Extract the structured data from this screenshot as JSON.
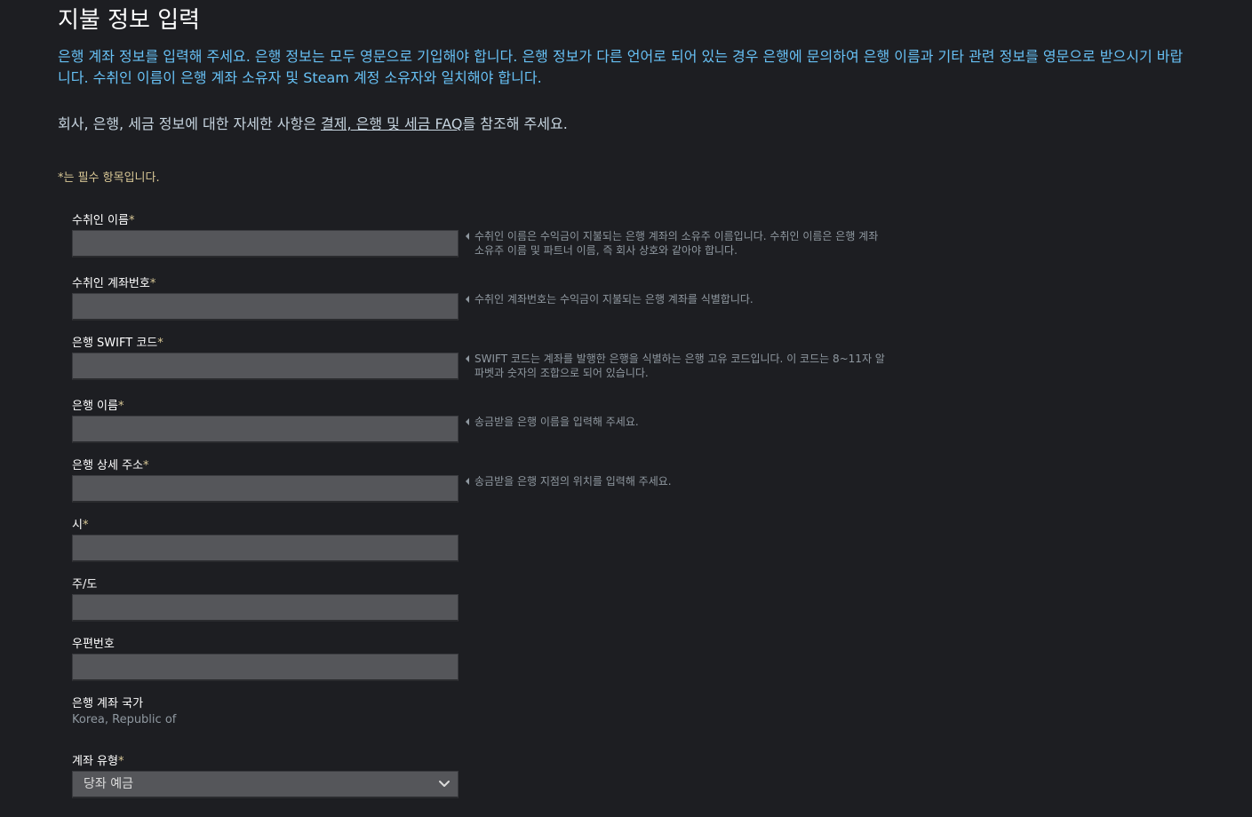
{
  "title": "지불 정보 입력",
  "intro": "은행 계좌 정보를 입력해 주세요. 은행 정보는 모두 영문으로 기입해야 합니다. 은행 정보가 다른 언어로 되어 있는 경우 은행에 문의하여 은행 이름과 기타 관련 정보를 영문으로 받으시기 바랍니다. 수취인 이름이 은행 계좌 소유자 및 Steam 계정 소유자와 일치해야 합니다.",
  "faq": {
    "prefix": "회사, 은행, 세금 정보에 대한 자세한 사항은 ",
    "link": "결제, 은행 및 세금 FAQ",
    "suffix": "를 참조해 주세요."
  },
  "required_note": "*는 필수 항목입니다.",
  "required_mark": "*",
  "fields": {
    "payee_name": {
      "label": "수취인 이름",
      "value": "",
      "hint": "수취인 이름은 수익금이 지불되는 은행 계좌의 소유주 이름입니다. 수취인 이름은 은행 계좌 소유주 이름 및 파트너 이름, 즉 회사 상호와 같아야 합니다."
    },
    "account_number": {
      "label": "수취인 계좌번호",
      "value": "",
      "hint": "수취인 계좌번호는 수익금이 지불되는 은행 계좌를 식별합니다."
    },
    "swift_code": {
      "label": "은행 SWIFT 코드",
      "value": "",
      "hint": "SWIFT 코드는 계좌를 발행한 은행을 식별하는 은행 고유 코드입니다. 이 코드는 8~11자 알파벳과 숫자의 조합으로 되어 있습니다."
    },
    "bank_name": {
      "label": "은행 이름",
      "value": "",
      "hint": "송금받을 은행 이름을 입력해 주세요."
    },
    "bank_address": {
      "label": "은행 상세 주소",
      "value": "",
      "hint": "송금받을 은행 지점의 위치를 입력해 주세요."
    },
    "city": {
      "label": "시",
      "value": ""
    },
    "state": {
      "label": "주/도",
      "value": ""
    },
    "postal_code": {
      "label": "우편번호",
      "value": ""
    }
  },
  "country": {
    "label": "은행 계좌 국가",
    "value": "Korea, Republic of"
  },
  "account_type": {
    "label": "계좌 유형",
    "selected": "당좌 예금"
  },
  "colors": {
    "background": "#1d1e22",
    "link_blue": "#67c1f5",
    "required_gold": "#d9c896",
    "input_bg": "#55565a",
    "hint_gray": "#8f98a0"
  },
  "icons": {
    "hint_arrow": "caret-left-icon",
    "select_arrow": "chevron-down-icon"
  }
}
